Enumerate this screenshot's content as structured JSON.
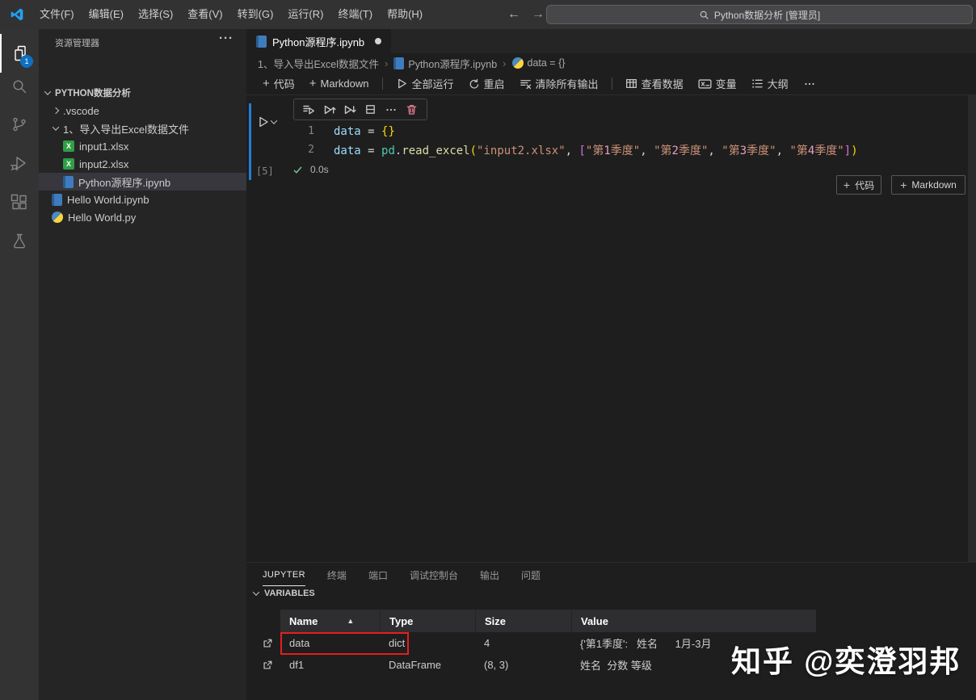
{
  "colors": {
    "accent": "#007acc",
    "focus_cell": "#1f7fd4",
    "highlight_box": "#e61e1e",
    "badge": "#0e70c0"
  },
  "titlebar": {
    "menus": [
      "文件(F)",
      "编辑(E)",
      "选择(S)",
      "查看(V)",
      "转到(G)",
      "运行(R)",
      "终端(T)",
      "帮助(H)"
    ],
    "search": "Python数据分析 [管理员]",
    "back": "←",
    "forward": "→"
  },
  "activity_bar": {
    "items": [
      {
        "name": "explorer",
        "active": true,
        "badge": "1"
      },
      {
        "name": "search"
      },
      {
        "name": "source-control"
      },
      {
        "name": "run-debug"
      },
      {
        "name": "extensions"
      },
      {
        "name": "testing"
      }
    ]
  },
  "sidebar": {
    "title": "资源管理器",
    "root": "PYTHON数据分析",
    "items": [
      {
        "label": ".vscode",
        "level": 1,
        "chevron": "collapsed"
      },
      {
        "label": "1、导入导出Excel数据文件",
        "level": 1,
        "chevron": "expanded"
      },
      {
        "label": "input1.xlsx",
        "level": 2,
        "icon": "excel"
      },
      {
        "label": "input2.xlsx",
        "level": 2,
        "icon": "excel"
      },
      {
        "label": "Python源程序.ipynb",
        "level": 2,
        "icon": "notebook",
        "selected": true
      },
      {
        "label": "Hello World.ipynb",
        "level": 1,
        "icon": "notebook"
      },
      {
        "label": "Hello World.py",
        "level": 1,
        "icon": "python"
      }
    ]
  },
  "editor": {
    "tab": {
      "label": "Python源程序.ipynb",
      "modified": true
    },
    "breadcrumbs": [
      {
        "label": "1、导入导出Excel数据文件"
      },
      {
        "label": "Python源程序.ipynb",
        "icon": "notebook"
      },
      {
        "label": "data = {}",
        "icon": "python"
      }
    ],
    "toolbar": [
      {
        "icon": "plus",
        "label": "代码"
      },
      {
        "icon": "plus",
        "label": "Markdown"
      },
      {
        "divider": true
      },
      {
        "icon": "run-all",
        "label": "全部运行"
      },
      {
        "icon": "restart",
        "label": "重启"
      },
      {
        "icon": "clear-outputs",
        "label": "清除所有输出"
      },
      {
        "divider": true
      },
      {
        "icon": "data-viewer",
        "label": "查看数据"
      },
      {
        "icon": "variables",
        "label": "变量"
      },
      {
        "icon": "outline",
        "label": "大纲"
      },
      {
        "icon": "more",
        "label": ""
      }
    ],
    "cell": {
      "exec_count": "[5]",
      "duration": "0.0s",
      "toolbar_icons": [
        "execute-above-cells",
        "run-above",
        "run-below",
        "split-cell",
        "more-actions",
        "delete-cell"
      ],
      "lines": [
        [
          [
            "v",
            "data"
          ],
          [
            "o",
            " = "
          ],
          [
            "b1",
            "{}"
          ]
        ],
        [
          [
            "v",
            "data"
          ],
          [
            "o",
            " = "
          ],
          [
            "m",
            "pd"
          ],
          [
            "o",
            "."
          ],
          [
            "f",
            "read_excel"
          ],
          [
            "b1",
            "("
          ],
          [
            "s",
            "\"input2.xlsx\""
          ],
          [
            "o",
            ", "
          ],
          [
            "b2",
            "["
          ],
          [
            "s",
            "\"第"
          ],
          [
            "sn",
            "1"
          ],
          [
            "s",
            "季度\""
          ],
          [
            "o",
            ", "
          ],
          [
            "s",
            "\"第"
          ],
          [
            "sn",
            "2"
          ],
          [
            "s",
            "季度\""
          ],
          [
            "o",
            ", "
          ],
          [
            "s",
            "\"第"
          ],
          [
            "sn",
            "3"
          ],
          [
            "s",
            "季度\""
          ],
          [
            "o",
            ", "
          ],
          [
            "s",
            "\"第"
          ],
          [
            "sn",
            "4"
          ],
          [
            "s",
            "季度\""
          ],
          [
            "b2",
            "]"
          ],
          [
            "b1",
            ")"
          ]
        ]
      ],
      "add_code": "代码",
      "add_markdown": "Markdown"
    }
  },
  "panel": {
    "tabs": [
      {
        "label": "JUPYTER",
        "active": true
      },
      {
        "label": "终端"
      },
      {
        "label": "端口"
      },
      {
        "label": "调试控制台"
      },
      {
        "label": "输出"
      },
      {
        "label": "问题"
      }
    ],
    "section": "VARIABLES",
    "table": {
      "columns": [
        "Name",
        "Type",
        "Size",
        "Value"
      ],
      "rows": [
        {
          "name": "data",
          "type": "dict",
          "size": "4",
          "value": "{'第1季度':   姓名      1月-3月",
          "highlighted": true
        },
        {
          "name": "df1",
          "type": "DataFrame",
          "size": "(8, 3)",
          "value": "姓名  分数 等级"
        }
      ]
    }
  },
  "watermark": {
    "text": "知乎 @奕澄羽邦"
  }
}
